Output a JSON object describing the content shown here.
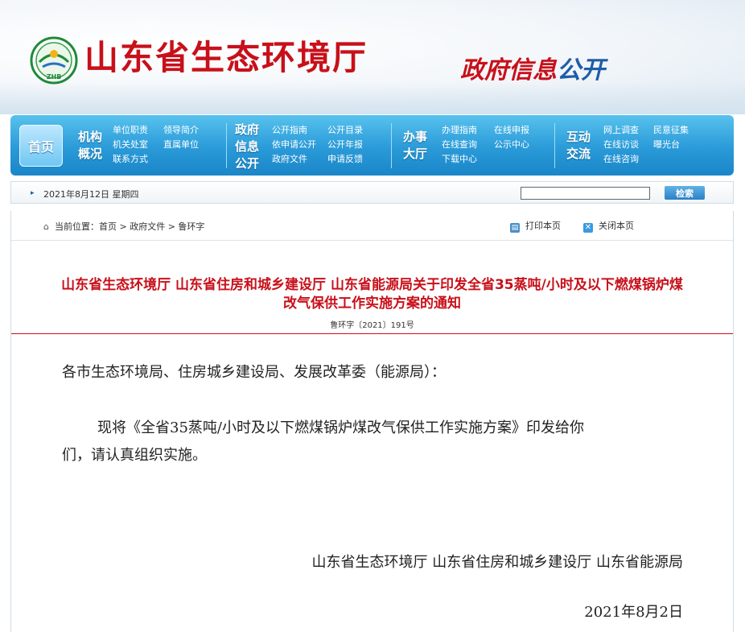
{
  "header": {
    "site_title": "山东省生态环境厅",
    "logo_text": "ZHB",
    "gov_info_red": "政府信息",
    "gov_info_blue": "公开",
    "accent_color": "#c8101a"
  },
  "nav": {
    "home": "首页",
    "sections": [
      {
        "title_line1": "机构",
        "title_line2": "概况",
        "title_line3": "",
        "links": [
          "单位职责",
          "领导简介",
          "机关处室",
          "直属单位",
          "联系方式"
        ]
      },
      {
        "title_line1": "政府",
        "title_line2": "信息",
        "title_line3": "公开",
        "links": [
          "公开指南",
          "公开目录",
          "依申请公开",
          "公开年报",
          "政府文件",
          "申请反馈"
        ]
      },
      {
        "title_line1": "办事",
        "title_line2": "大厅",
        "title_line3": "",
        "links": [
          "办理指南",
          "在线申报",
          "在线查询",
          "公示中心",
          "下载中心"
        ]
      },
      {
        "title_line1": "互动",
        "title_line2": "交流",
        "title_line3": "",
        "links": [
          "网上调查",
          "民意征集",
          "在线访谈",
          "曝光台",
          "在线咨询"
        ]
      }
    ]
  },
  "datebar": {
    "date": "2021年8月12日 星期四",
    "search_value": "",
    "search_button": "检索"
  },
  "breadcrumb": {
    "text": "当前位置：首页 > 政府文件 > 鲁环字",
    "print": "打印本页",
    "close": "关闭本页"
  },
  "document": {
    "title_line1": "山东省生态环境厅 山东省住房和城乡建设厅 山东省能源局关于印发全省35蒸吨/小时及以下燃煤锅炉煤",
    "title_line2": "改气保供工作实施方案的通知",
    "doc_number": "鲁环字〔2021〕191号",
    "salutation": "各市生态环境局、住房城乡建设局、发展改革委（能源局）：",
    "body_line1": "现将《全省35蒸吨/小时及以下燃煤锅炉煤改气保供工作实施方案》印发给你",
    "body_line2": "们，请认真组织实施。",
    "signatories": "山东省生态环境厅 山东省住房和城乡建设厅 山东省能源局",
    "date": "2021年8月2日"
  }
}
